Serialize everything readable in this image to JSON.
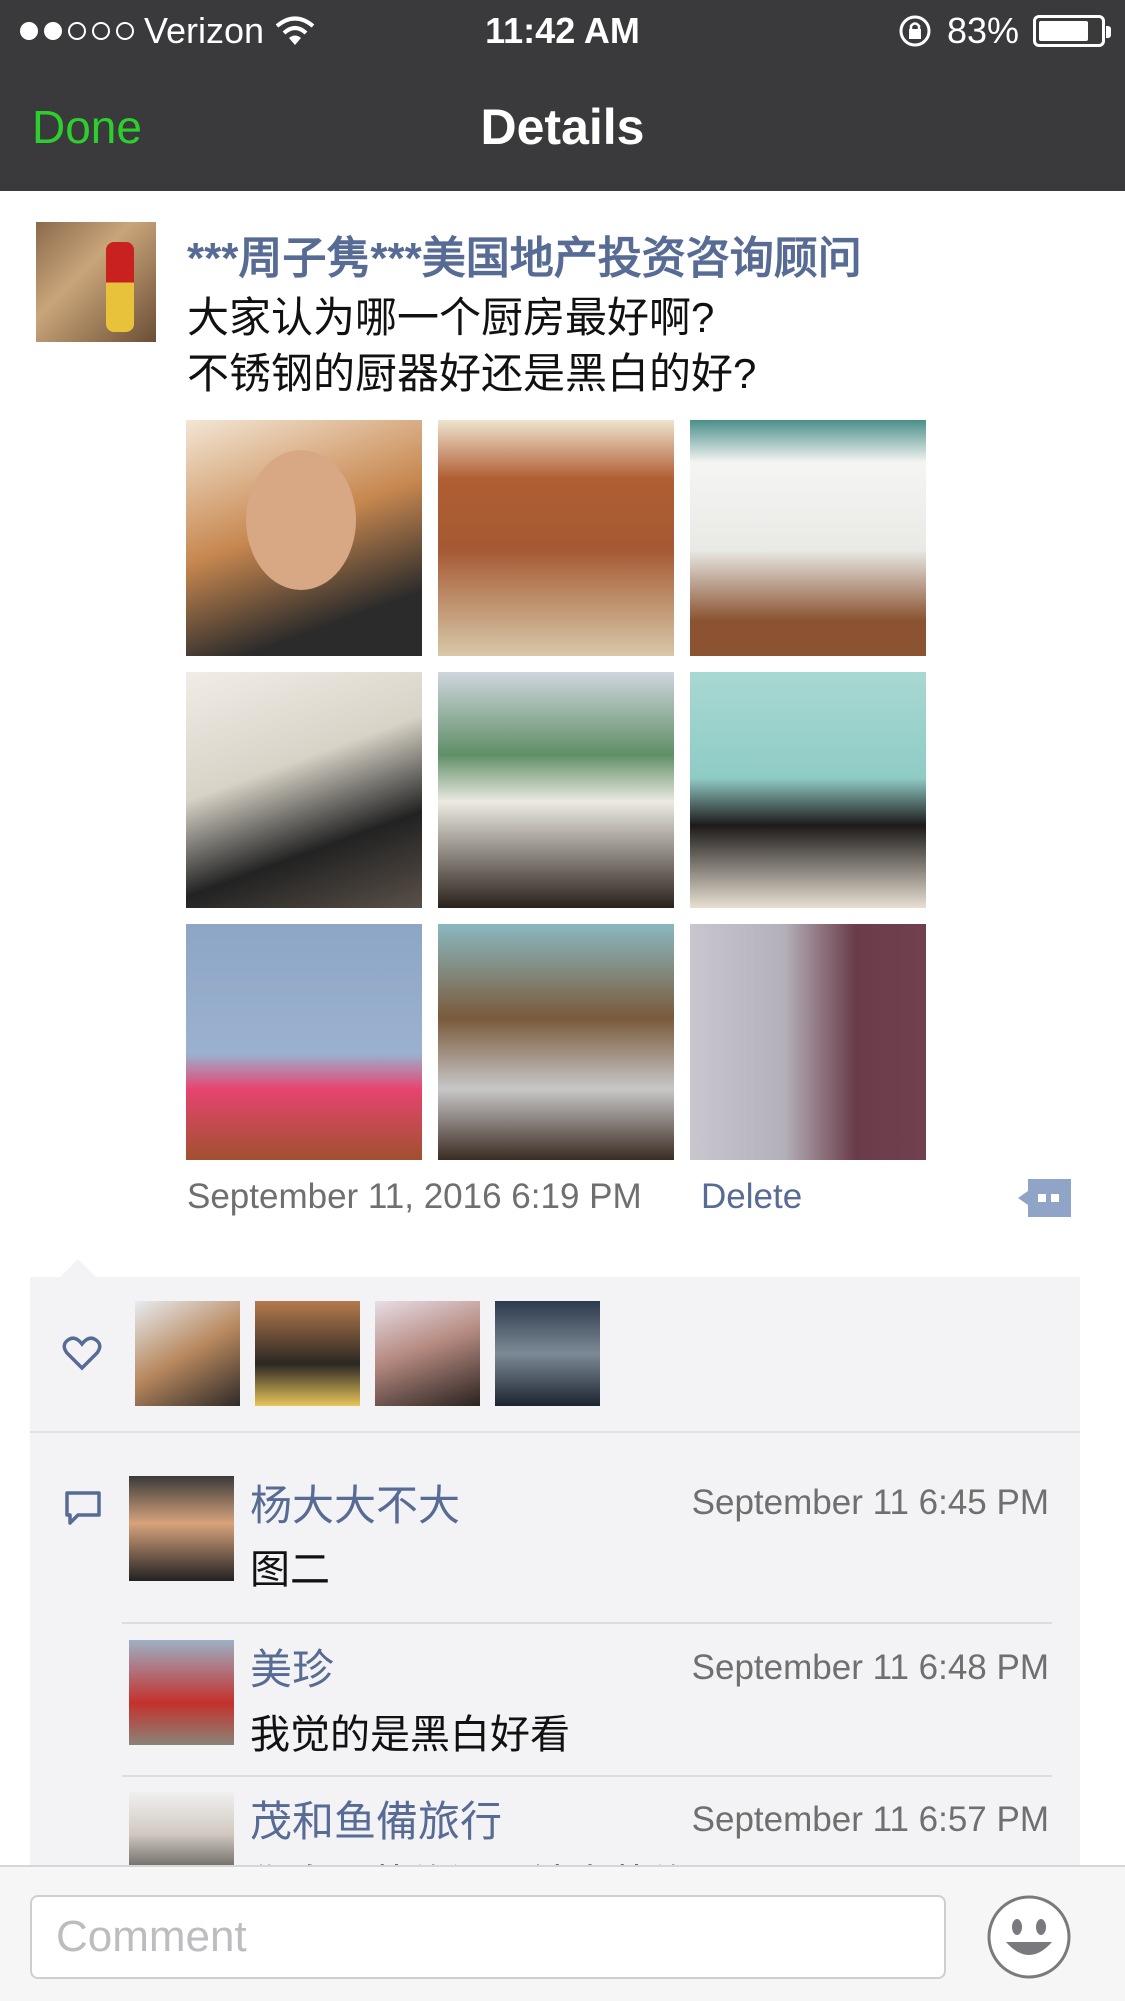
{
  "status_bar": {
    "carrier": "Verizon",
    "time": "11:42 AM",
    "battery": "83%",
    "battery_level": 0.83,
    "signal_bars_filled": 2,
    "signal_bars_total": 5
  },
  "nav": {
    "done_label": "Done",
    "title": "Details",
    "done_color": "#2ccf2c"
  },
  "post": {
    "author": "***周子隽***美国地产投资咨询顾问",
    "text": "大家认为哪一个厨房最好啊?\n不锈钢的厨器好还是黑白的好?",
    "photo_count": 9,
    "timestamp": "September 11, 2016 6:19 PM",
    "delete_label": "Delete",
    "link_color": "#576b95"
  },
  "likes": {
    "icon": "heart-icon",
    "count_shown": 4
  },
  "comments": [
    {
      "name": "杨大大不大",
      "time": "September 11 6:45 PM",
      "text": "图二"
    },
    {
      "name": "美珍",
      "time": "September 11 6:48 PM",
      "text": "我觉的是黑白好看"
    },
    {
      "name": "茂和鱼備旅行",
      "time": "September 11 6:57 PM",
      "text": "你自己装修還是請人装修"
    }
  ],
  "comment_bar": {
    "placeholder": "Comment",
    "emoji_icon": "smiley-icon"
  }
}
